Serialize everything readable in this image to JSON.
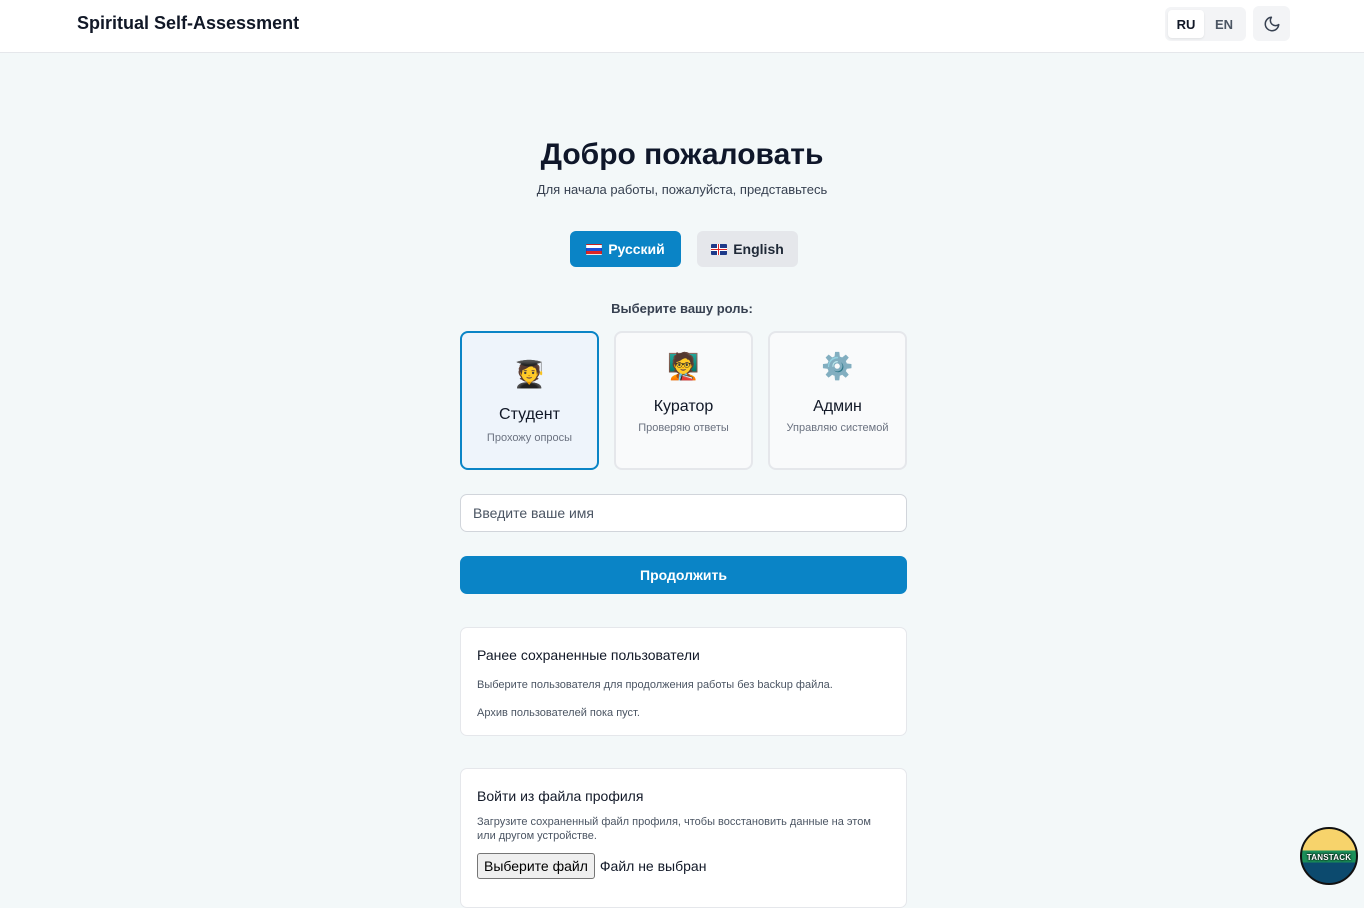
{
  "header": {
    "title": "Spiritual Self-Assessment",
    "lang_ru": "RU",
    "lang_en": "EN",
    "theme_icon": "moon-icon"
  },
  "welcome": {
    "title": "Добро пожаловать",
    "subtitle": "Для начала работы, пожалуйста, представьтесь"
  },
  "language_choice": {
    "russian": "Русский",
    "english": "English",
    "selected": "Русский"
  },
  "roles": {
    "prompt": "Выберите вашу роль:",
    "selected": "Студент",
    "items": [
      {
        "emoji": "🧑‍🎓",
        "title": "Студент",
        "desc": "Прохожу опросы"
      },
      {
        "emoji": "🧑‍🏫",
        "title": "Куратор",
        "desc": "Проверяю ответы"
      },
      {
        "emoji": "⚙️",
        "title": "Админ",
        "desc": "Управляю системой"
      }
    ]
  },
  "name_input": {
    "placeholder": "Введите ваше имя",
    "value": ""
  },
  "continue_label": "Продолжить",
  "saved_users": {
    "title": "Ранее сохраненные пользователи",
    "hint": "Выберите пользователя для продолжения работы без backup файла.",
    "empty": "Архив пользователей пока пуст."
  },
  "profile_file": {
    "title": "Войти из файла профиля",
    "hint": "Загрузите сохраненный файл профиля, чтобы восстановить данные на этом или другом устройстве.",
    "choose_label": "Выберите файл",
    "status": "Файл не выбран"
  },
  "devtools": {
    "label": "TANSTACK"
  },
  "colors": {
    "accent": "#0a84c6",
    "background": "#f3f8f9"
  }
}
